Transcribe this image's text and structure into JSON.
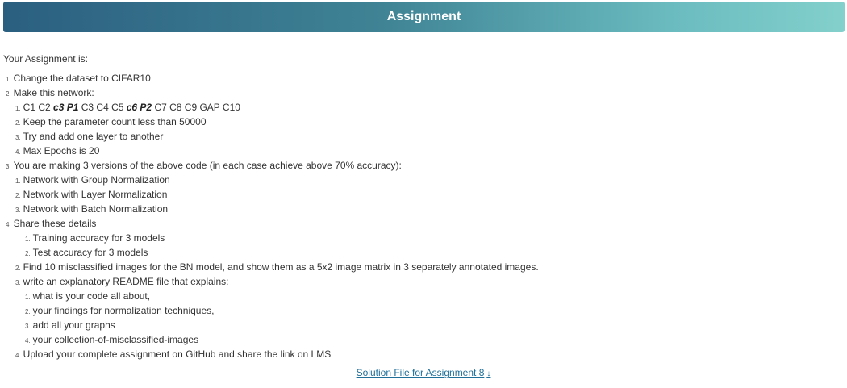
{
  "header": {
    "title": "Assignment"
  },
  "intro": "Your Assignment is:",
  "items": [
    {
      "num": "1.",
      "text": "Change the dataset to CIFAR10"
    },
    {
      "num": "2.",
      "text": "Make this network:"
    },
    {
      "num": "1.",
      "network": {
        "a": "C1 C2 ",
        "b": "c3 P1",
        "c": " C3 C4 C5 ",
        "d": "c6 P2",
        "e": " C7 C8 C9 GAP C10"
      }
    },
    {
      "num": "2.",
      "text": "Keep the parameter count less than 50000"
    },
    {
      "num": "3.",
      "text": "Try and add one layer to another"
    },
    {
      "num": "4.",
      "text": "Max Epochs is 20"
    },
    {
      "num": "3.",
      "text": "You are making 3 versions of the above code (in each case achieve above 70% accuracy):"
    },
    {
      "num": "1.",
      "text": "Network with Group Normalization"
    },
    {
      "num": "2.",
      "text": "Network with Layer Normalization"
    },
    {
      "num": "3.",
      "text": "Network with Batch Normalization"
    },
    {
      "num": "4.",
      "text": "Share these details"
    },
    {
      "num": "1.",
      "text": "Training accuracy for 3 models"
    },
    {
      "num": "2.",
      "text": "Test accuracy for 3 models"
    },
    {
      "num": "2.",
      "text": "Find 10 misclassified images for the BN model, and show them as a 5x2 image matrix in 3 separately annotated images."
    },
    {
      "num": "3.",
      "text": "write an explanatory README file that explains:"
    },
    {
      "num": "1.",
      "text": "what is your code all about,"
    },
    {
      "num": "2.",
      "text": "your findings for normalization techniques,"
    },
    {
      "num": "3.",
      "text": "add all your graphs"
    },
    {
      "num": "4.",
      "text": "your collection-of-misclassified-images"
    },
    {
      "num": "4.",
      "text": "Upload your complete assignment on GitHub and share the link on LMS"
    }
  ],
  "solution_link": {
    "label": "Solution File for Assignment 8",
    "icon": "download-arrow-icon",
    "glyph": "↓"
  },
  "colors": {
    "header_start": "#2b5f80",
    "header_end": "#83d0cc",
    "link": "#1f6f99",
    "text": "#333333"
  }
}
